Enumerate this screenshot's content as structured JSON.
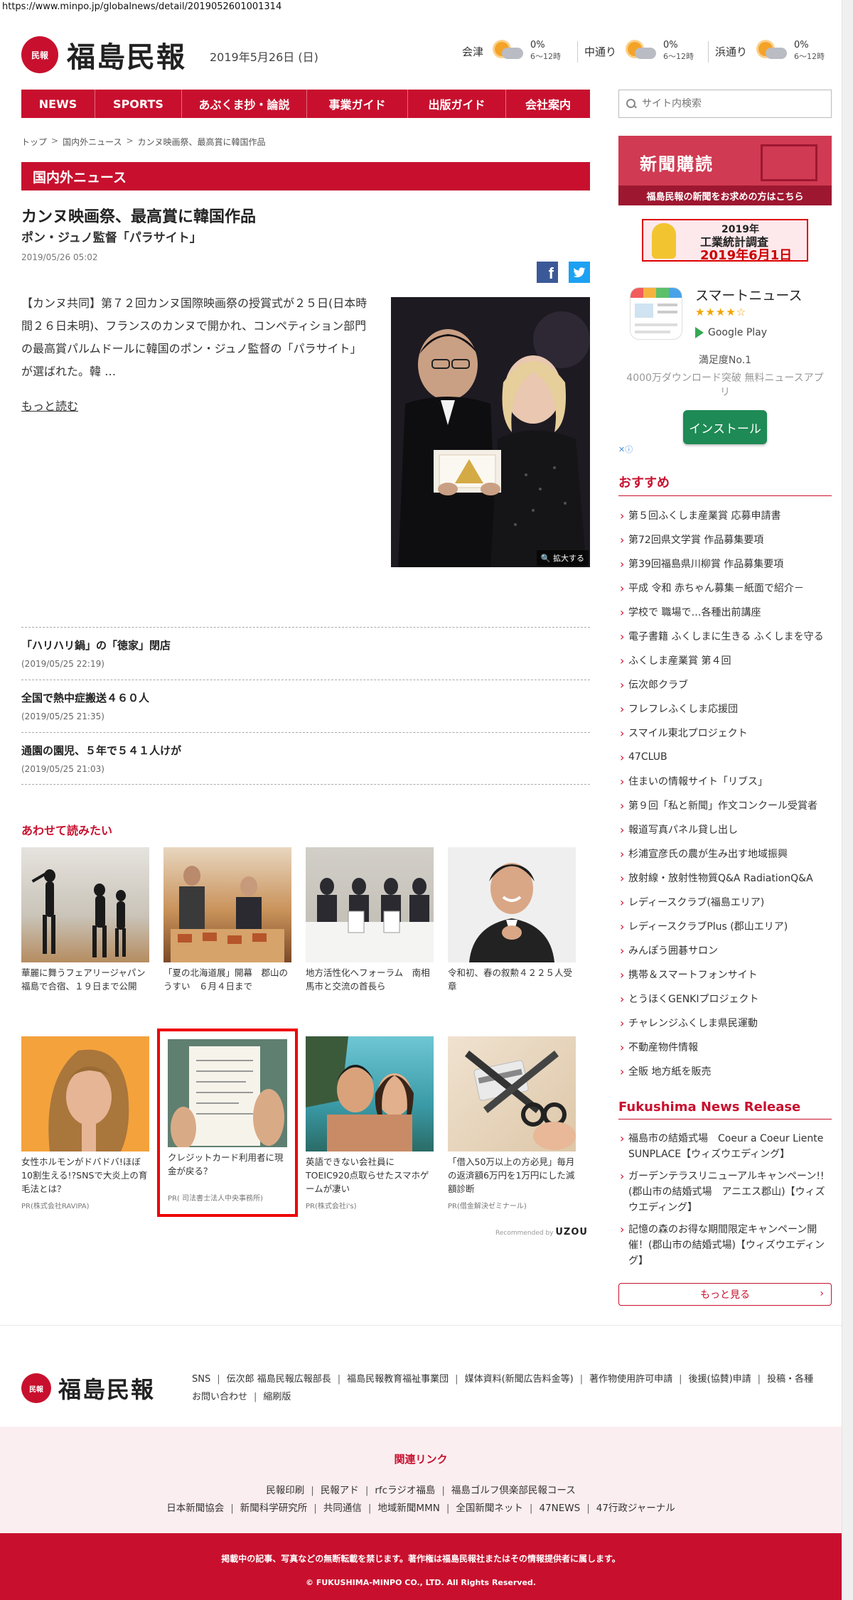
{
  "url": "https://www.minpo.jp/globalnews/detail/2019052601001314",
  "header": {
    "logo_mark": "民報",
    "logo_text": "福島民報",
    "date": "2019年5月26日 (日)",
    "weather": [
      {
        "city": "会津",
        "pct": "0%",
        "time": "6〜12時"
      },
      {
        "city": "中通り",
        "pct": "0%",
        "time": "6〜12時"
      },
      {
        "city": "浜通り",
        "pct": "0%",
        "time": "6〜12時"
      }
    ]
  },
  "nav": {
    "items": [
      "NEWS",
      "SPORTS",
      "あぶくま抄・論説",
      "事業ガイド",
      "出版ガイド",
      "会社案内"
    ]
  },
  "search": {
    "placeholder": "サイト内検索"
  },
  "breadcrumb": [
    "トップ",
    "国内外ニュース",
    "カンヌ映画祭、最高賞に韓国作品"
  ],
  "section": {
    "title": "国内外ニュース"
  },
  "article": {
    "title": "カンヌ映画祭、最高賞に韓国作品",
    "subtitle": "ポン・ジュノ監督「パラサイト」",
    "date": "2019/05/26 05:02",
    "body": "【カンヌ共同】第７２回カンヌ国際映画祭の授賞式が２５日(日本時間２６日未明)、フランスのカンヌで開かれ、コンペティション部門の最高賞パルムドールに韓国のポン・ジュノ監督の「パラサイト」が選ばれた。韓 …",
    "read_more": "もっと読む",
    "photo_enlarge": "拡大する",
    "share_fb": "f"
  },
  "related": [
    {
      "title": "「ハリハリ鍋」の「徳家」閉店",
      "date": "(2019/05/25 22:19)"
    },
    {
      "title": "全国で熱中症搬送４６０人",
      "date": "(2019/05/25 21:35)"
    },
    {
      "title": "通園の園児、５年で５４１人けが",
      "date": "(2019/05/25 21:03)"
    }
  ],
  "recommend": {
    "heading": "あわせて読みたい",
    "cards": [
      {
        "title": "華麗に舞うフェアリージャパン　福島で合宿、１９日まで公開",
        "pr": ""
      },
      {
        "title": "「夏の北海道展」開幕　郡山のうすい　６月４日まで",
        "pr": ""
      },
      {
        "title": "地方活性化へフォーラム　南相馬市と交流の首長ら",
        "pr": ""
      },
      {
        "title": "令和初、春の叙勲４２２５人受章",
        "pr": ""
      },
      {
        "title": "女性ホルモンがドバドバ!ほぼ10割生える!?SNSで大炎上の育毛法とは？",
        "pr": "PR(株式会社RAVIPA)"
      },
      {
        "title": "クレジットカード利用者に現金が戻る？",
        "pr": "PR( 司法書士法人中央事務所)"
      },
      {
        "title": "英語できない会社員にTOEIC920点取らせたスマホゲームが凄い",
        "pr": "PR(株式会社i's)"
      },
      {
        "title": "「借入50万以上の方必見」毎月の返済額6万円を1万円にした減額診断",
        "pr": "PR(借金解決ゼミナール)"
      }
    ],
    "recommended_by": "Recommended by",
    "recommended_brand": "UZOU"
  },
  "sidebar": {
    "subscribe": {
      "title": "新聞購読",
      "band": "福島民報の新聞をお求めの方はこちら"
    },
    "survey": {
      "year": "2019年",
      "name": "工業統計調査",
      "date": "2019年6月1日"
    },
    "app": {
      "name": "スマートニュース",
      "stars": "★★★★☆",
      "store": "Google Play",
      "satisfaction": "満足度No.1",
      "desc": "4000万ダウンロード突破 無料ニュースアプリ",
      "install": "インストール",
      "adchoice": "✕ⓘ"
    },
    "osusume_heading": "おすすめ",
    "osusume": [
      "第５回ふくしま産業賞 応募申請書",
      "第72回県文学賞 作品募集要項",
      "第39回福島県川柳賞 作品募集要項",
      "平成 令和 赤ちゃん募集－紙面で紹介－",
      "学校で 職場で…各種出前講座",
      "電子書籍 ふくしまに生きる ふくしまを守る",
      "ふくしま産業賞 第４回",
      "伝次郎クラブ",
      "フレフレふくしま応援団",
      "スマイル東北プロジェクト",
      "47CLUB",
      "住まいの情報サイト「リブス」",
      "第９回「私と新聞」作文コンクール受賞者",
      "報道写真パネル貸し出し",
      "杉浦宣彦氏の農が生み出す地域振興",
      "放射線・放射性物質Q&A RadiationQ&A",
      "レディースクラブ(福島エリア)",
      "レディースクラブPlus (郡山エリア)",
      "みんぽう囲碁サロン",
      "携帯＆スマートフォンサイト",
      "とうほくGENKIプロジェクト",
      "チャレンジふくしま県民運動",
      "不動産物件情報",
      "全販 地方紙を販売"
    ],
    "release_heading": "Fukushima News Release",
    "releases": [
      "福島市の結婚式場　Coeur a Coeur Liente SUNPLACE【ウィズウエディング】",
      "ガーデンテラスリニューアルキャンペーン!!(郡山市の結婚式場　アニエス郡山)【ウィズウエディング】",
      "記憶の森のお得な期間限定キャンペーン開催！(郡山市の結婚式場)【ウィズウエディング】"
    ],
    "more": "もっと見る"
  },
  "footer": {
    "links": [
      "SNS",
      "伝次郎 福島民報広報部長",
      "福島民報教育福祉事業団",
      "媒体資料(新聞広告料金等)",
      "著作物使用許可申請",
      "後援(協賛)申請",
      "投稿・各種お問い合わせ",
      "縮刷版"
    ],
    "related_heading": "関連リンク",
    "related_row1": [
      "民報印刷",
      "民報アド",
      "rfcラジオ福島",
      "福島ゴルフ倶楽部民報コース"
    ],
    "related_row2": [
      "日本新聞協会",
      "新聞科学研究所",
      "共同通信",
      "地域新聞MMN",
      "全国新聞ネット",
      "47NEWS",
      "47行政ジャーナル"
    ],
    "notice": "掲載中の記事、写真などの無断転載を禁じます。著作権は福島民報社またはその情報提供者に属します。",
    "copyright": "© FUKUSHIMA-MINPO CO., LTD. All Rights Reserved."
  },
  "colors": {
    "brand": "#c8102e",
    "twitter": "#1da1f2",
    "facebook": "#3b5998",
    "install": "#1e8a55"
  }
}
